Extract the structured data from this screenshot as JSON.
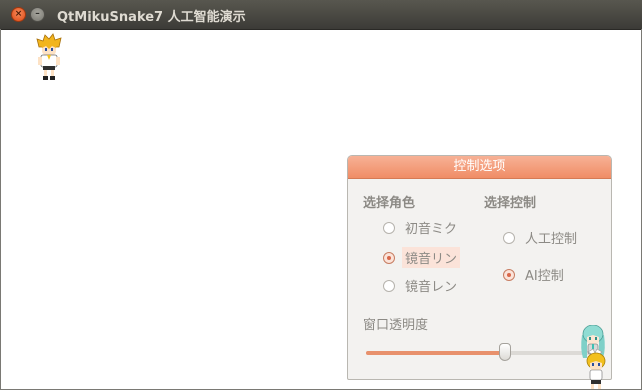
{
  "window": {
    "title": "QtMikuSnake7 人工智能演示",
    "close_icon": "close-icon",
    "minimize_icon": "minimize-icon"
  },
  "sprites": {
    "len_character": "len-sprite",
    "miku_character": "miku-sprite",
    "rin_character": "rin-sprite"
  },
  "control_panel": {
    "title": "控制选项",
    "role_group": {
      "title": "选择角色",
      "options": [
        "初音ミク",
        "镜音リン",
        "镜音レン"
      ],
      "selected": "镜音リン"
    },
    "control_group": {
      "title": "选择控制",
      "options": [
        "人工控制",
        "AI控制"
      ],
      "selected": "AI控制"
    },
    "opacity": {
      "label": "窗口透明度",
      "value_fraction": 0.6
    }
  },
  "colors": {
    "accent": "#f08d66",
    "title_bar": "#3c3b37"
  }
}
